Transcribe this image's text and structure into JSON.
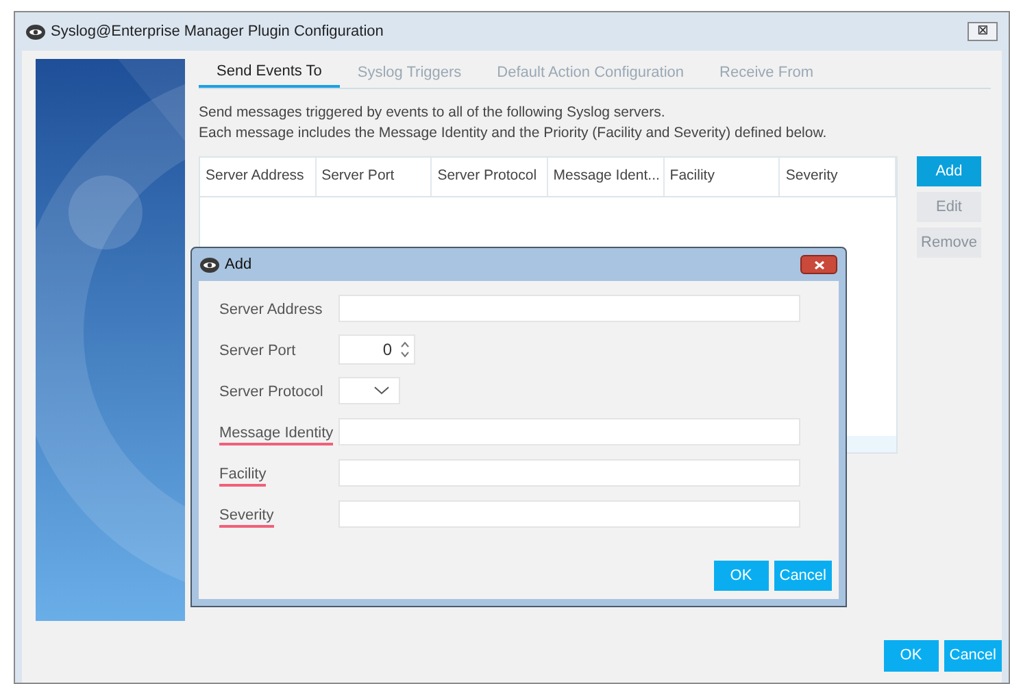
{
  "window": {
    "title": "Syslog@Enterprise Manager Plugin Configuration",
    "close_label": "⊠"
  },
  "tabs": [
    {
      "label": "Send Events To",
      "selected": true
    },
    {
      "label": "Syslog Triggers",
      "selected": false
    },
    {
      "label": "Default Action Configuration",
      "selected": false
    },
    {
      "label": "Receive From",
      "selected": false
    }
  ],
  "description": [
    "Send messages triggered by events to all of the following Syslog servers.",
    "Each message includes the Message Identity and the Priority (Facility and Severity) defined below."
  ],
  "table": {
    "columns": [
      "Server Address",
      "Server Port",
      "Server Protocol",
      "Message Ident...",
      "Facility",
      "Severity"
    ]
  },
  "side_buttons": [
    {
      "label": "Add",
      "disabled": false
    },
    {
      "label": "Edit",
      "disabled": true
    },
    {
      "label": "Remove",
      "disabled": true
    }
  ],
  "dialog": {
    "title": "Add",
    "fields": [
      {
        "label": "Server Address",
        "kind": "text",
        "flagged": false
      },
      {
        "label": "Server Port",
        "kind": "spinner",
        "value": "0",
        "flagged": false
      },
      {
        "label": "Server Protocol",
        "kind": "dropdown",
        "flagged": false
      },
      {
        "label": "Message Identity",
        "kind": "text",
        "flagged": true
      },
      {
        "label": "Facility",
        "kind": "text",
        "flagged": true
      },
      {
        "label": "Severity",
        "kind": "text",
        "flagged": true
      }
    ],
    "buttons": [
      "OK",
      "Cancel"
    ]
  },
  "buttons": [
    "OK",
    "Cancel"
  ]
}
